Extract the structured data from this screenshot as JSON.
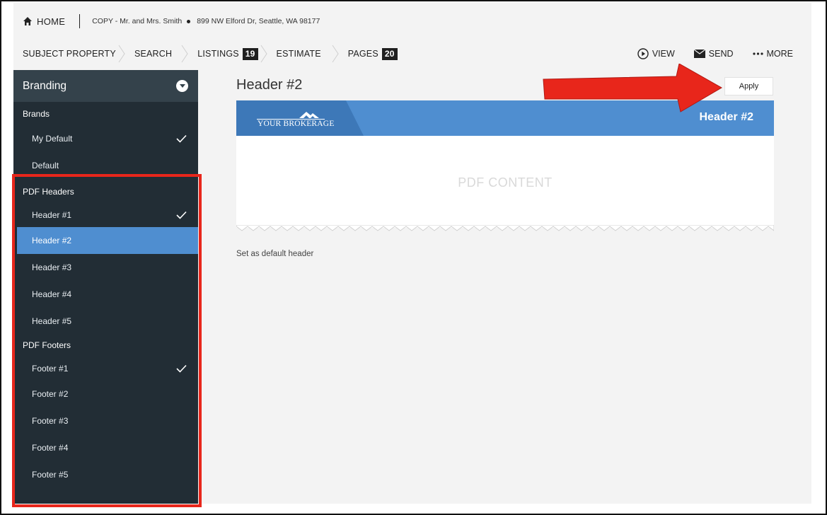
{
  "topbar": {
    "home_label": "HOME",
    "copy_label": "COPY - Mr. and Mrs. Smith",
    "address": "899 NW Elford Dr, Seattle, WA 98177"
  },
  "nav": {
    "subject_property": "SUBJECT PROPERTY",
    "search": "SEARCH",
    "listings": "LISTINGS",
    "listings_count": "19",
    "estimate": "ESTIMATE",
    "pages": "PAGES",
    "pages_count": "20"
  },
  "actions": {
    "view": "VIEW",
    "send": "SEND",
    "more": "MORE"
  },
  "sidebar": {
    "title": "Branding",
    "brands_heading": "Brands",
    "brands": [
      {
        "label": "My Default",
        "checked": true
      },
      {
        "label": "Default",
        "checked": false
      }
    ],
    "headers_heading": "PDF Headers",
    "headers": [
      {
        "label": "Header #1",
        "checked": true
      },
      {
        "label": "Header #2",
        "active": true
      },
      {
        "label": "Header #3"
      },
      {
        "label": "Header #4"
      },
      {
        "label": "Header #5"
      }
    ],
    "footers_heading": "PDF Footers",
    "footers": [
      {
        "label": "Footer #1",
        "checked": true
      },
      {
        "label": "Footer #2"
      },
      {
        "label": "Footer #3"
      },
      {
        "label": "Footer #4"
      },
      {
        "label": "Footer #5"
      }
    ]
  },
  "main": {
    "title": "Header #2",
    "apply_label": "Apply",
    "preview": {
      "brand": "YOUR BROKERAGE",
      "header_title": "Header #2",
      "content": "PDF CONTENT"
    },
    "default_label": "Set as default header"
  },
  "colors": {
    "sidebar_bg": "#222d35",
    "active_item": "#4f8ed0",
    "annotation_red": "#e8261b"
  }
}
